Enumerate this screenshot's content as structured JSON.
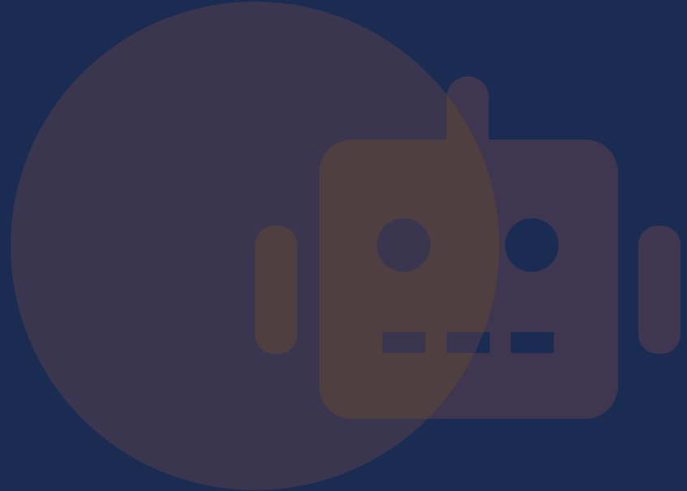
{
  "colors": {
    "background": "#1b2c52",
    "circle": "#3a3650",
    "robot": "#3f3651",
    "overlap": "#4f3f40"
  },
  "icon": "robot-icon"
}
